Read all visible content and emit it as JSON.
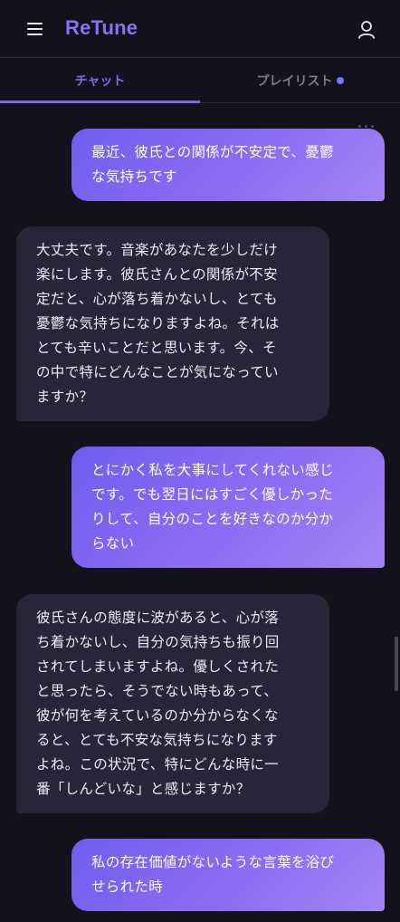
{
  "app": {
    "title": "ReTune"
  },
  "header": {
    "menu_icon": "hamburger-menu-icon",
    "user_icon": "user-icon"
  },
  "tabs": [
    {
      "label": "チャット",
      "active": true
    },
    {
      "label": "プレイリスト",
      "active": false,
      "has_notification_dot": true
    }
  ],
  "messages": [
    {
      "role": "user",
      "text": "最近、彼氏との関係が不安定で、憂鬱\nな気持ちです"
    },
    {
      "role": "assistant",
      "text": "大丈夫です。音楽があなたを少しだけ\n楽にします。彼氏さんとの関係が不安\n定だと、心が落ち着かないし、とても\n憂鬱な気持ちになりますよね。それは\nとても辛いことだと思います。今、そ\nの中で特にどんなことが気になってい\nますか？"
    },
    {
      "role": "user",
      "text": "とにかく私を大事にしてくれない感じ\nです。でも翌日にはすごく優しかった\nりして、自分のことを好きなのか分か\nらない"
    },
    {
      "role": "assistant",
      "text": "彼氏さんの態度に波があると、心が落\nち着かないし、自分の気持ちも振り回\nされてしまいますよね。優しくされた\nと思ったら、そうでない時もあって、\n彼が何を考えているのか分からなくな\nると、とても不安な気持ちになります\nよね。この状況で、特にどんな時に一\n番「しんどいな」と感じますか？"
    },
    {
      "role": "user",
      "text": "私の存在価値がないような言葉を浴び\nせられた時"
    }
  ],
  "colors": {
    "accent": "#7d68ec",
    "background": "#13121c",
    "bot_bubble": "#26253a"
  }
}
